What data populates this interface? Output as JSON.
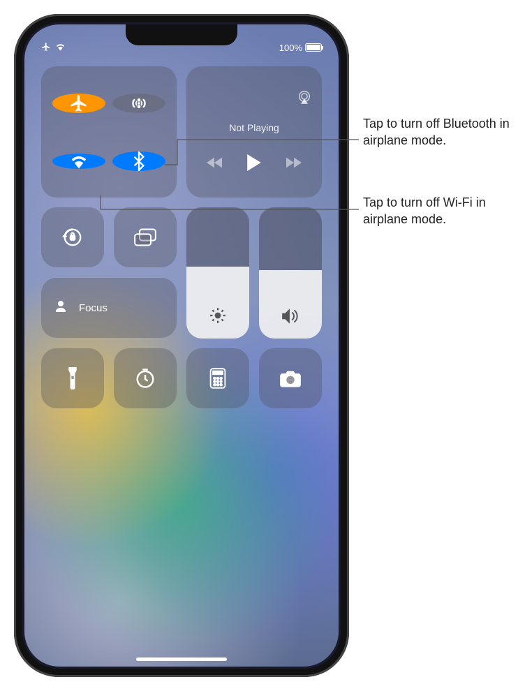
{
  "status_bar": {
    "battery_percent": "100%"
  },
  "media": {
    "title": "Not Playing"
  },
  "focus": {
    "label": "Focus"
  },
  "sliders": {
    "brightness_percent": 55,
    "volume_percent": 52
  },
  "connectivity": {
    "airplane_on": true,
    "cellular_on": false,
    "wifi_on": true,
    "bluetooth_on": true
  },
  "callouts": {
    "bluetooth": "Tap to turn off Bluetooth in airplane mode.",
    "wifi": "Tap to turn off Wi-Fi in airplane mode."
  }
}
